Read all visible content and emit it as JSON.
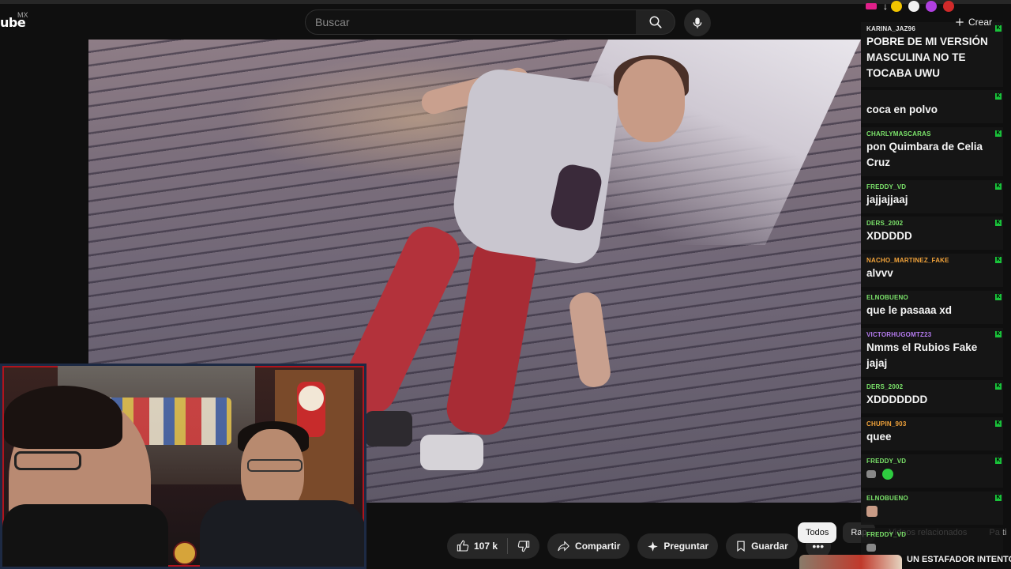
{
  "header": {
    "logo_text": "ube",
    "region": "MX",
    "search_placeholder": "Buscar",
    "create_label": "Crear"
  },
  "actions": {
    "like_count": "107 k",
    "share_label": "Compartir",
    "ask_label": "Preguntar",
    "save_label": "Guardar"
  },
  "chips": [
    {
      "label": "Todos",
      "active": true
    },
    {
      "label": "Rap"
    },
    {
      "label": "Videos relacionados"
    },
    {
      "label": "Pa ti"
    }
  ],
  "next_video": {
    "title": "UN ESTAFADOR INTENTÓ"
  },
  "chat": [
    {
      "user": "KARINA_JAZ96",
      "color": "#e6e6e6",
      "text": "POBRE DE MI VERSIÓN MASCULINA NO TE TOCABA UWU"
    },
    {
      "user": "",
      "color": "#d0223a",
      "text": "coca en polvo"
    },
    {
      "user": "CHARLYMASCARAS",
      "color": "#7be36a",
      "text": "pon Quimbara de Celia Cruz"
    },
    {
      "user": "FREDDY_VD",
      "color": "#7be36a",
      "text": "jajjajjaaj"
    },
    {
      "user": "DERS_2002",
      "color": "#7be36a",
      "text": "XDDDDD"
    },
    {
      "user": "NACHO_MARTINEZ_FAKE",
      "color": "#f2a33a",
      "text": "alvvv"
    },
    {
      "user": "ELNOBUENO",
      "color": "#7be36a",
      "text": "que le pasaaa xd"
    },
    {
      "user": "VICTORHUGOMTZ23",
      "color": "#b57bf0",
      "text": "Nmms el Rubios Fake jajaj"
    },
    {
      "user": "DERS_2002",
      "color": "#7be36a",
      "text": "XDDDDDDD"
    },
    {
      "user": "CHUPIN_903",
      "color": "#f2a33a",
      "text": "quee"
    },
    {
      "user": "FREDDY_VD",
      "color": "#7be36a",
      "text": ""
    },
    {
      "user": "ELNOBUENO",
      "color": "#7be36a",
      "text": ""
    },
    {
      "user": "FREDDY_VD",
      "color": "#7be36a",
      "text": ""
    }
  ]
}
